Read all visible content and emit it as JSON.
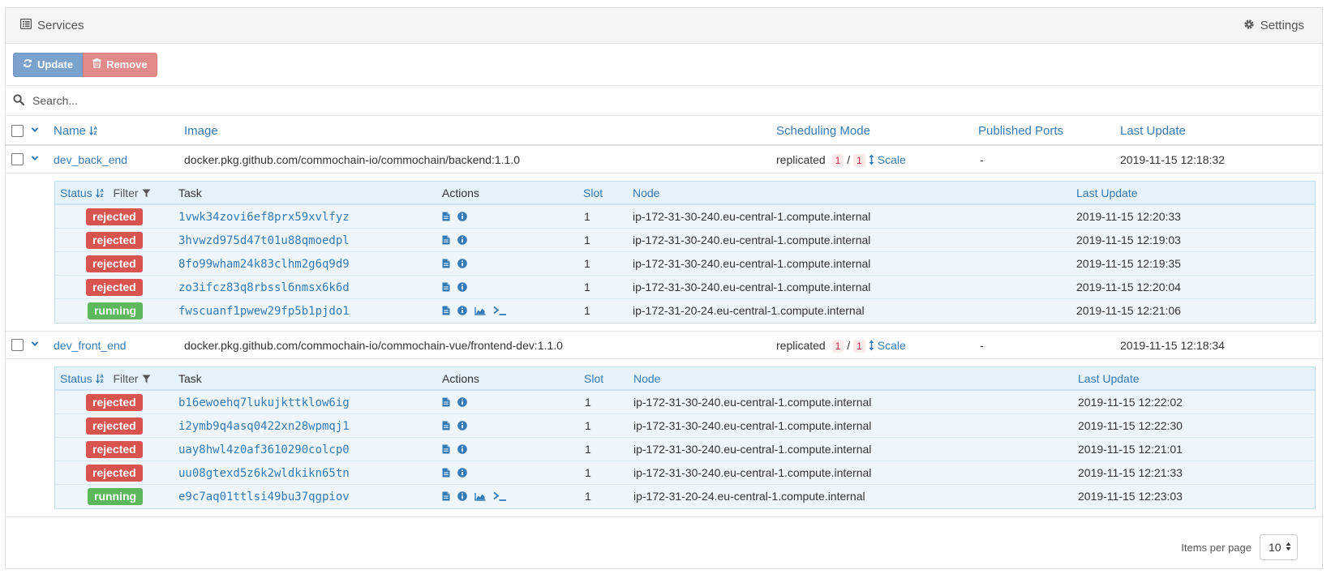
{
  "header": {
    "title": "Services",
    "settings_label": "Settings"
  },
  "toolbar": {
    "update_label": "Update",
    "remove_label": "Remove"
  },
  "search": {
    "placeholder": "Search..."
  },
  "columns": {
    "name": "Name",
    "image": "Image",
    "scheduling_mode": "Scheduling Mode",
    "published_ports": "Published Ports",
    "last_update": "Last Update"
  },
  "task_columns": {
    "status": "Status",
    "filter": "Filter",
    "task": "Task",
    "actions": "Actions",
    "slot": "Slot",
    "node": "Node",
    "last_update": "Last Update"
  },
  "services": [
    {
      "name": "dev_back_end",
      "image": "docker.pkg.github.com/commochain-io/commochain/backend:1.1.0",
      "mode": "replicated",
      "running": "1",
      "separator": "/",
      "desired": "1",
      "scale_label": "Scale",
      "ports": "-",
      "last_update": "2019-11-15 12:18:32",
      "tasks": [
        {
          "status": "rejected",
          "id": "1vwk34zovi6ef8prx59xvlfyz",
          "slot": "1",
          "node": "ip-172-31-30-240.eu-central-1.compute.internal",
          "updated": "2019-11-15 12:20:33"
        },
        {
          "status": "rejected",
          "id": "3hvwzd975d47t01u88qmoedpl",
          "slot": "1",
          "node": "ip-172-31-30-240.eu-central-1.compute.internal",
          "updated": "2019-11-15 12:19:03"
        },
        {
          "status": "rejected",
          "id": "8fo99wham24k83clhm2g6q9d9",
          "slot": "1",
          "node": "ip-172-31-30-240.eu-central-1.compute.internal",
          "updated": "2019-11-15 12:19:35"
        },
        {
          "status": "rejected",
          "id": "zo3ifcz83q8rbssl6nmsx6k6d",
          "slot": "1",
          "node": "ip-172-31-30-240.eu-central-1.compute.internal",
          "updated": "2019-11-15 12:20:04"
        },
        {
          "status": "running",
          "id": "fwscuanf1pwew29fp5b1pjdo1",
          "slot": "1",
          "node": "ip-172-31-20-24.eu-central-1.compute.internal",
          "updated": "2019-11-15 12:21:06"
        }
      ]
    },
    {
      "name": "dev_front_end",
      "image": "docker.pkg.github.com/commochain-io/commochain-vue/frontend-dev:1.1.0",
      "mode": "replicated",
      "running": "1",
      "separator": "/",
      "desired": "1",
      "scale_label": "Scale",
      "ports": "-",
      "last_update": "2019-11-15 12:18:34",
      "tasks": [
        {
          "status": "rejected",
          "id": "b16ewoehq7lukujkttklow6ig",
          "slot": "1",
          "node": "ip-172-31-30-240.eu-central-1.compute.internal",
          "updated": "2019-11-15 12:22:02"
        },
        {
          "status": "rejected",
          "id": "i2ymb9q4asq0422xn28wpmqj1",
          "slot": "1",
          "node": "ip-172-31-30-240.eu-central-1.compute.internal",
          "updated": "2019-11-15 12:22:30"
        },
        {
          "status": "rejected",
          "id": "uay8hwl4z0af3610290colcp0",
          "slot": "1",
          "node": "ip-172-31-30-240.eu-central-1.compute.internal",
          "updated": "2019-11-15 12:21:01"
        },
        {
          "status": "rejected",
          "id": "uu08gtexd5z6k2wldkikn65tn",
          "slot": "1",
          "node": "ip-172-31-30-240.eu-central-1.compute.internal",
          "updated": "2019-11-15 12:21:33"
        },
        {
          "status": "running",
          "id": "e9c7aq01ttlsi49bu37qgpiov",
          "slot": "1",
          "node": "ip-172-31-20-24.eu-central-1.compute.internal",
          "updated": "2019-11-15 12:23:03"
        }
      ]
    }
  ],
  "pagination": {
    "items_per_page_label": "Items per page",
    "value": "10"
  },
  "colors": {
    "link": "#337ab7",
    "rejected": "#d9534f",
    "running": "#5cb85c",
    "update_btn": "#7aa2cc",
    "remove_btn": "#e38b8b"
  }
}
